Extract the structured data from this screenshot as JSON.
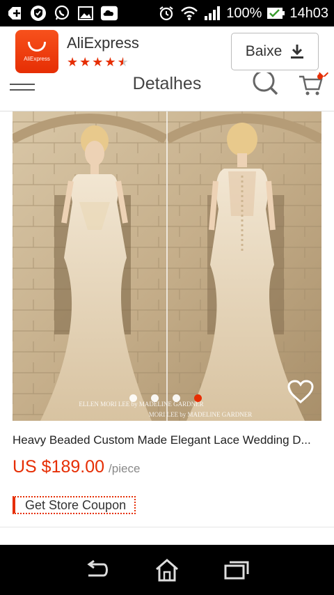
{
  "status_bar": {
    "icons": [
      "plus-icon",
      "shield-icon",
      "whatsapp-icon",
      "image-icon",
      "cloud-icon",
      "alarm-icon",
      "wifi-icon",
      "signal-icon",
      "battery-icon"
    ],
    "battery": "100%",
    "time": "14h03"
  },
  "banner": {
    "app_name": "AliExpress",
    "logo_text": "AliExpress",
    "rating": 4.5,
    "download_label": "Baixe",
    "accent_color": "#e62e04"
  },
  "header": {
    "title": "Detalhes"
  },
  "product": {
    "image_watermark_left": "ELLEN MORI LEE by MADELINE GARDNER",
    "image_watermark_right": "MORI LEE by MADELINE GARDNER",
    "slide_count": 4,
    "active_slide": 4,
    "title": "Heavy Beaded Custom Made Elegant Lace Wedding D...",
    "price": "US $189.00",
    "unit": "/piece",
    "coupon_label": "Get Store Coupon"
  },
  "nav_bar": {
    "buttons": [
      "back-icon",
      "home-icon",
      "recent-apps-icon"
    ]
  }
}
